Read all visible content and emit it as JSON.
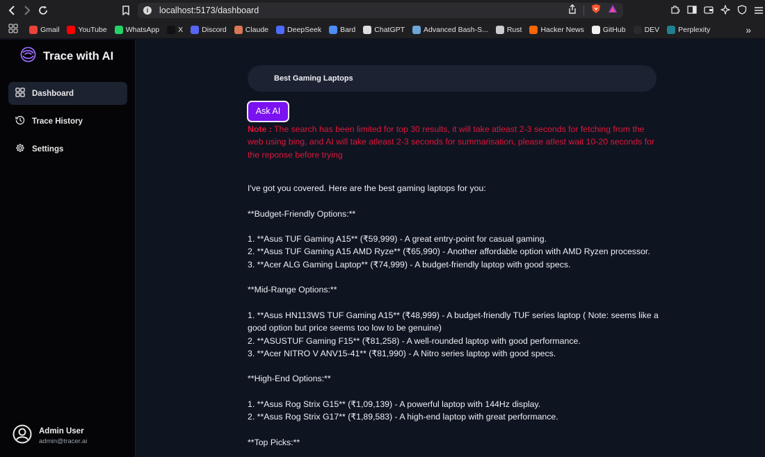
{
  "browser": {
    "url": "localhost:5173/dashboard",
    "bookmarks": [
      {
        "label": "Gmail",
        "color": "#ea4335"
      },
      {
        "label": "YouTube",
        "color": "#ff0000"
      },
      {
        "label": "WhatsApp",
        "color": "#25d366"
      },
      {
        "label": "X",
        "color": "#111111"
      },
      {
        "label": "Discord",
        "color": "#5865f2"
      },
      {
        "label": "Claude",
        "color": "#d97757"
      },
      {
        "label": "DeepSeek",
        "color": "#4d6bfe"
      },
      {
        "label": "Bard",
        "color": "#4c8df6"
      },
      {
        "label": "ChatGPT",
        "color": "#dddddd"
      },
      {
        "label": "Advanced Bash-S...",
        "color": "#6ea6d8"
      },
      {
        "label": "Rust",
        "color": "#cccccc"
      },
      {
        "label": "Hacker News",
        "color": "#ff6600"
      },
      {
        "label": "GitHub",
        "color": "#f0f0f0"
      },
      {
        "label": "DEV",
        "color": "#2a2a2a"
      },
      {
        "label": "Perplexity",
        "color": "#20808d"
      }
    ],
    "more": "»"
  },
  "sidebar": {
    "brand": "Trace with AI",
    "items": [
      {
        "label": "Dashboard",
        "icon": "grid-icon"
      },
      {
        "label": "Trace History",
        "icon": "history-icon"
      },
      {
        "label": "Settings",
        "icon": "gear-icon"
      }
    ],
    "user": {
      "name": "Admin User",
      "email": "admin@tracer.ai"
    }
  },
  "main": {
    "query": "Best Gaming Laptops",
    "ask_label": "Ask AI",
    "note_label": "Note :",
    "note_text": " The search has been limited for top 30 results, it will take atleast 2-3 seconds for fetching from the web using bing, and AI will take atleast 2-3 seconds for summarisation, please atlest wait 10-20 seconds for the reponse before trying",
    "response": [
      "I've got you covered. Here are the best gaming laptops for you:",
      "",
      "**Budget-Friendly Options:**",
      "",
      "1. **Asus TUF Gaming A15** (₹59,999) - A great entry-point for casual gaming.",
      "2. **Asus TUF Gaming A15 AMD Ryze** (₹65,990) - Another affordable option with AMD Ryzen processor.",
      "3. **Acer ALG Gaming Laptop** (₹74,999) - A budget-friendly laptop with good specs.",
      "",
      "**Mid-Range Options:**",
      "",
      "1. **Asus HN113WS TUF Gaming A15** (₹48,999) - A budget-friendly TUF series laptop ( Note: seems like a good option but price seems too low to be genuine)",
      "2. **ASUSTUF Gaming F15** (₹81,258) - A well-rounded laptop with good performance.",
      "3. **Acer NITRO V ANV15-41** (₹81,990) - A Nitro series laptop with good specs.",
      "",
      "**High-End Options:**",
      "",
      "1. **Asus Rog Strix G15** (₹1,09,139) - A powerful laptop with 144Hz display.",
      "2. **Asus Rog Strix G17** (₹1,89,583) - A high-end laptop with great performance.",
      "",
      "**Top Picks:**"
    ]
  }
}
